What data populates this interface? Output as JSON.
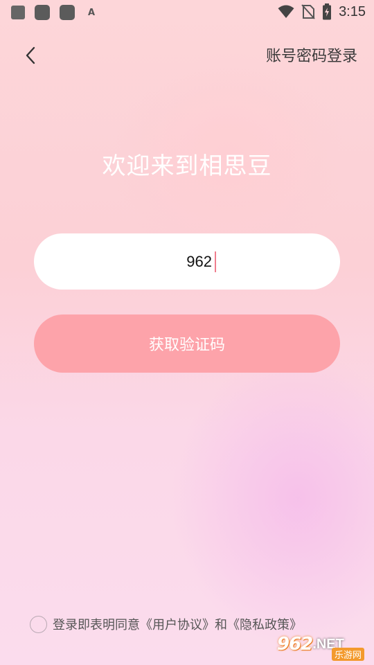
{
  "status_bar": {
    "time": "3:15",
    "left_icons": [
      "app-icon",
      "app-icon",
      "app-icon",
      "accessibility-icon"
    ],
    "accessibility_glyph": "A",
    "right_icons": [
      "wifi-icon",
      "no-sim-icon",
      "battery-charging-icon"
    ]
  },
  "header": {
    "account_login_label": "账号密码登录"
  },
  "welcome_title": "欢迎来到相思豆",
  "phone_input": {
    "value": "962"
  },
  "get_code_button": "获取验证码",
  "agreement": {
    "checked": false,
    "prefix": "登录即表明同意",
    "user_agreement": "《用户协议》",
    "conjunction": "和",
    "privacy_policy": "《隐私政策》"
  },
  "watermark": {
    "logo": "962",
    "domain": ".NET",
    "subtitle": "乐游网"
  },
  "colors": {
    "primary_button": "#fda3aa",
    "caret": "#f07e8e",
    "title": "#ffffff"
  }
}
